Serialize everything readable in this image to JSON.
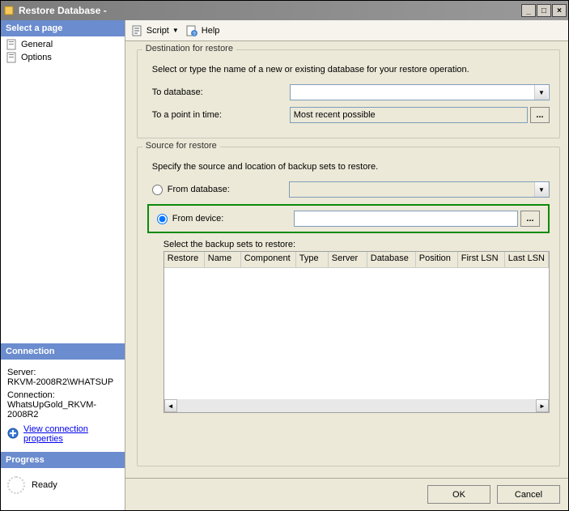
{
  "window": {
    "title": "Restore Database -"
  },
  "sidebar": {
    "select_header": "Select a page",
    "nav": [
      {
        "label": "General"
      },
      {
        "label": "Options"
      }
    ],
    "connection": {
      "header": "Connection",
      "server_label": "Server:",
      "server_value": "RKVM-2008R2\\WHATSUP",
      "conn_label": "Connection:",
      "conn_value": "WhatsUpGold_RKVM-2008R2",
      "link": "View connection properties"
    },
    "progress": {
      "header": "Progress",
      "status": "Ready"
    }
  },
  "toolbar": {
    "script": "Script",
    "help": "Help"
  },
  "destination": {
    "legend": "Destination for restore",
    "help": "Select or type the name of a new or existing database for your restore operation.",
    "db_label": "To database:",
    "db_value": "",
    "point_label": "To a point in time:",
    "point_value": "Most recent possible",
    "point_btn": "..."
  },
  "source": {
    "legend": "Source for restore",
    "help": "Specify the source and location of backup sets to restore.",
    "from_db_label": "From database:",
    "from_device_label": "From device:",
    "device_btn": "...",
    "select_sets_label": "Select the backup sets to restore:",
    "columns": [
      "Restore",
      "Name",
      "Component",
      "Type",
      "Server",
      "Database",
      "Position",
      "First LSN",
      "Last LSN"
    ]
  },
  "footer": {
    "ok": "OK",
    "cancel": "Cancel"
  }
}
